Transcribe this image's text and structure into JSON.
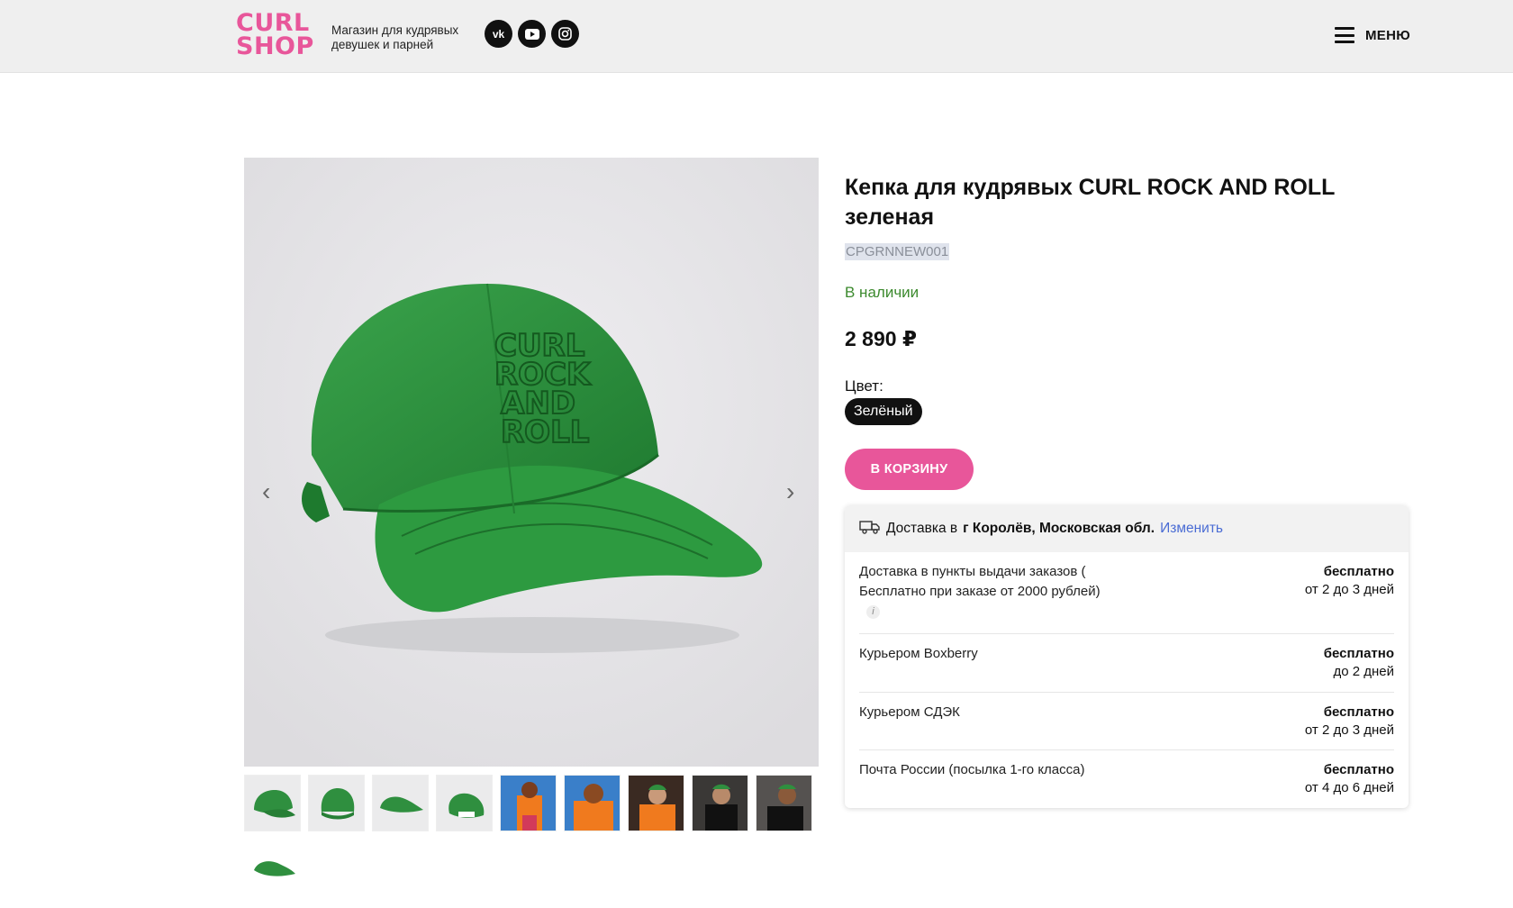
{
  "header": {
    "logo_line1": "CURL",
    "logo_line2": "SHOP",
    "tagline": "Магазин для кудрявых девушек и парней",
    "socials": [
      "vk-icon",
      "youtube-icon",
      "instagram-icon"
    ],
    "menu_label": "МЕНЮ"
  },
  "product": {
    "title": "Кепка для кудрявых CURL ROCK AND ROLL зеленая",
    "sku": "CPGRNNEW001",
    "stock": "В наличии",
    "price": "2 890 ₽",
    "color_label": "Цвет:",
    "color_value": "Зелёный",
    "cart_button": "В КОРЗИНУ",
    "brand_color": "#e8569a",
    "cap_color": "#2f8f3f"
  },
  "gallery": {
    "prev_glyph": "‹",
    "next_glyph": "›",
    "thumbs": [
      "cap",
      "cap",
      "cap",
      "cap",
      "model-blue-bg",
      "model-blue-bg",
      "model-orange",
      "model-dark",
      "model-dark",
      "cap"
    ]
  },
  "delivery": {
    "prefix": "Доставка в",
    "city": "г Королёв, Московская обл.",
    "change_link": "Изменить",
    "rows": [
      {
        "name": "Доставка в пункты выдачи заказов ( Бесплатно при заказе от 2000 рублей)",
        "price": "бесплатно",
        "term": "от 2 до 3 дней",
        "has_info": true
      },
      {
        "name": "Курьером Boxberry",
        "price": "бесплатно",
        "term": "до 2 дней"
      },
      {
        "name": "Курьером СДЭК",
        "price": "бесплатно",
        "term": "от 2 до 3 дней"
      },
      {
        "name": "Почта России (посылка 1-го класса)",
        "price": "бесплатно",
        "term": "от 4 до 6 дней"
      }
    ]
  }
}
